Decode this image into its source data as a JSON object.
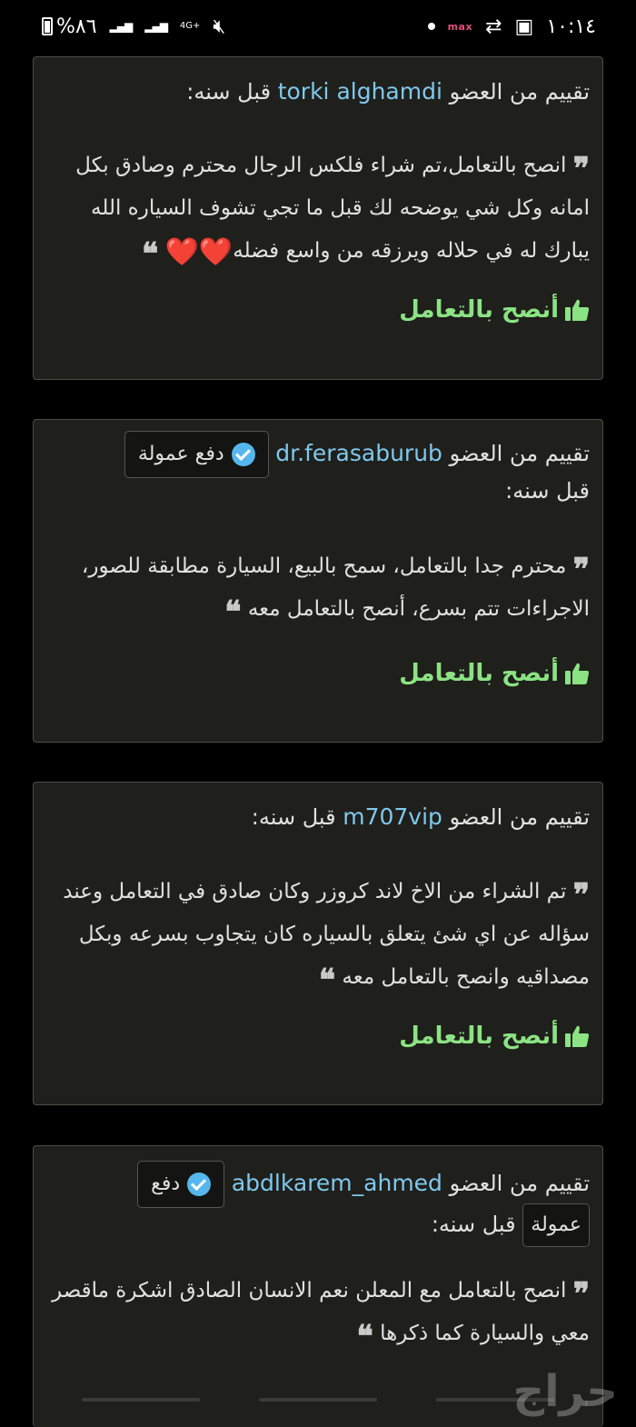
{
  "status_bar": {
    "time": "١٠:١٤",
    "carrier_badge": "max",
    "battery_percent": "%٨٦",
    "network": "4G+"
  },
  "reviews": [
    {
      "prefix": "تقييم من العضو",
      "username": "torki alghamdi",
      "suffix": "قبل سنه:",
      "text": "انصح بالتعامل،تم شراء فلكس الرجال محترم وصادق بكل امانه وكل شي يوضحه لك قبل ما تجي تشوف السياره الله يبارك له في حلاله ويرزقه من واسع فضله",
      "hearts": "❤️❤️",
      "recommend": "أنصح بالتعامل"
    },
    {
      "prefix": "تقييم من العضو",
      "username": "dr.ferasaburub",
      "badge": "دفع عمولة",
      "suffix": "قبل سنه:",
      "text": "محترم جدا بالتعامل، سمح بالبيع، السيارة مطابقة للصور، الاجراءات تتم بسرع، أنصح بالتعامل معه",
      "recommend": "أنصح بالتعامل"
    },
    {
      "prefix": "تقييم من العضو",
      "username": "m707vip",
      "suffix": "قبل سنه:",
      "text": "تم الشراء من الاخ لاند كروزر وكان صادق في التعامل وعند سؤاله عن اي شئ يتعلق بالسياره كان يتجاوب بسرعه وبكل مصداقيه وانصح بالتعامل معه",
      "recommend": "أنصح بالتعامل"
    },
    {
      "prefix": "تقييم من العضو",
      "username": "abdlkarem_ahmed",
      "badge_part1": "دفع",
      "badge_part2": "عمولة",
      "suffix": "قبل سنه:",
      "text": "انصح بالتعامل مع المعلن نعم الانسان الصادق اشكرة ماقصر معي والسيارة كما ذكرها"
    }
  ],
  "watermark": "حراج",
  "colors": {
    "background": "#000000",
    "card": "#1f1f1b",
    "username": "#7fc8ee",
    "recommend": "#8be383",
    "verified": "#56b7ee",
    "heart": "#e4263b"
  }
}
